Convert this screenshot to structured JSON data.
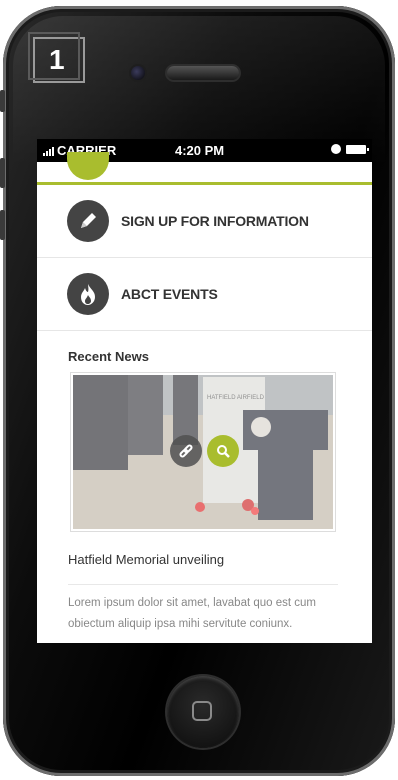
{
  "step_badge": "1",
  "status_bar": {
    "carrier": "CARRIER",
    "time": "4:20 PM"
  },
  "menu": [
    {
      "label": "SIGN UP FOR INFORMATION",
      "icon": "pencil-icon"
    },
    {
      "label": "ABCT EVENTS",
      "icon": "flame-icon"
    }
  ],
  "recent_news": {
    "heading": "Recent News",
    "item": {
      "title": "Hatfield Memorial unveiling",
      "excerpt": "Lorem ipsum dolor sit amet, lavabat quo est cum obiectum aliquip ipsa mihi servitute coniunx."
    },
    "memorial_text": "HATFIELD AIRFIELD"
  },
  "colors": {
    "accent": "#a9bd2e",
    "icon_bg": "#444444",
    "heading": "#333333",
    "muted_text": "#888888"
  }
}
